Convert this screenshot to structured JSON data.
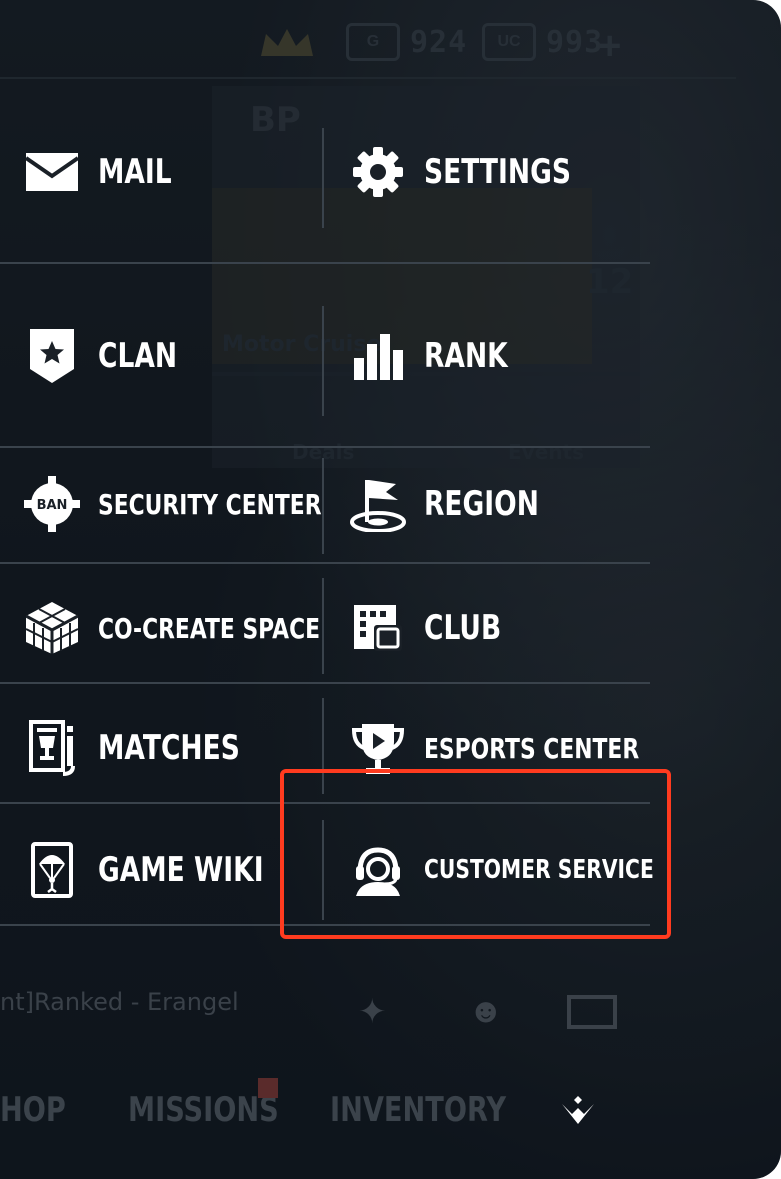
{
  "currency": {
    "coins": "924",
    "uc_label": "UC",
    "uc": "993",
    "coin_badge": "G"
  },
  "background": {
    "card1": "Motor Cruise",
    "card2": "Deals",
    "card3": "Events",
    "counter": "12",
    "bp_badge": "BP",
    "mode": "nt]Ranked - Erangel"
  },
  "menu": {
    "mail": "MAIL",
    "settings": "SETTINGS",
    "clan": "CLAN",
    "rank": "RANK",
    "security_center": "SECURITY CENTER",
    "security_badge": "BAN",
    "region": "REGION",
    "co_create_space": "CO-CREATE SPACE",
    "club": "CLUB",
    "matches": "MATCHES",
    "esports_center": "ESPORTS CENTER",
    "game_wiki": "GAME WIKI",
    "customer_service": "CUSTOMER SERVICE"
  },
  "bottom_nav": {
    "shop": "HOP",
    "missions": "MISSIONS",
    "inventory": "INVENTORY"
  },
  "colors": {
    "highlight": "#ff3b1f",
    "panel": "#151b22",
    "text": "#ffffff"
  }
}
